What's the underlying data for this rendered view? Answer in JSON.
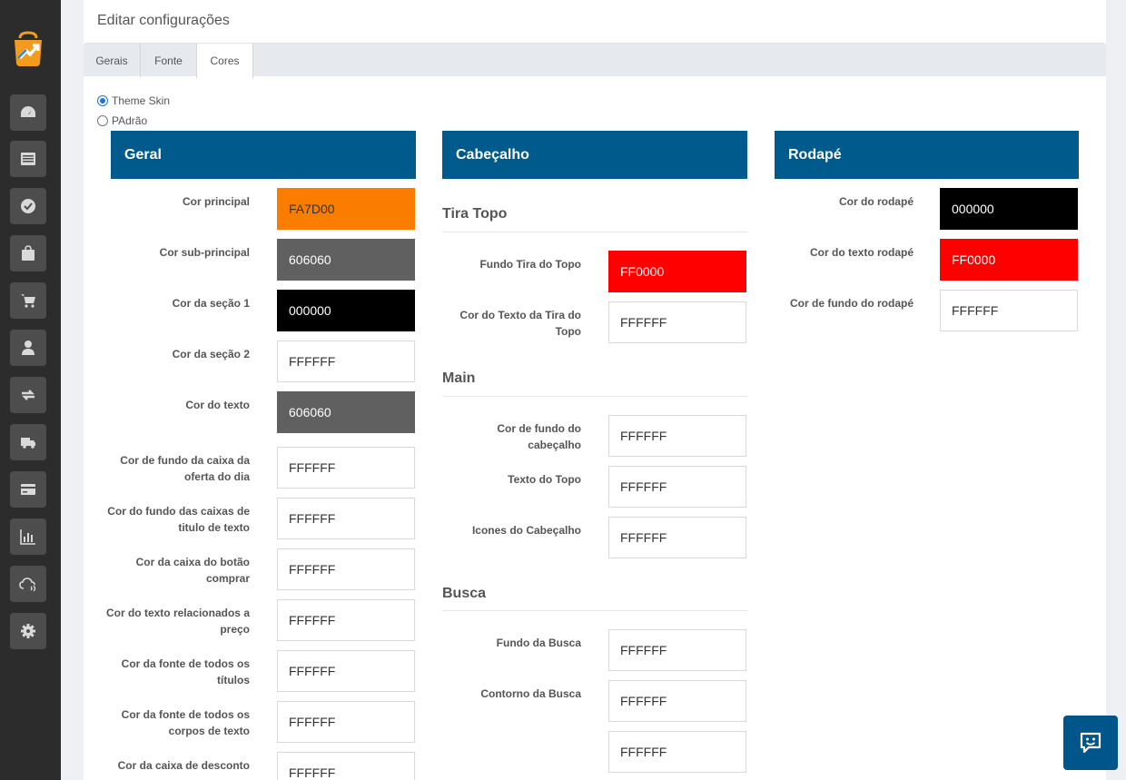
{
  "page_title": "Editar configurações",
  "tabs": [
    {
      "label": "Gerais"
    },
    {
      "label": "Fonte"
    },
    {
      "label": "Cores"
    }
  ],
  "theme_options": [
    {
      "label": "Theme Skin",
      "checked": true
    },
    {
      "label": "PAdrão",
      "checked": false
    }
  ],
  "sidebar_icons": [
    "dashboard-icon",
    "list-icon",
    "check-icon",
    "bag-icon",
    "cart-icon",
    "user-icon",
    "exchange-icon",
    "truck-icon",
    "card-icon",
    "chart-icon",
    "cloud-icon",
    "gear-icon"
  ],
  "geral": {
    "title": "Geral",
    "fields": [
      {
        "label": "Cor principal",
        "value": "FA7D00"
      },
      {
        "label": "Cor sub-principal",
        "value": "606060"
      },
      {
        "label": "Cor da seção 1",
        "value": "000000"
      },
      {
        "label": "Cor da seção 2",
        "value": "FFFFFF"
      },
      {
        "label": "Cor do texto",
        "value": "606060"
      },
      {
        "label": "Cor de fundo da caixa da oferta do dia",
        "value": "FFFFFF"
      },
      {
        "label": "Cor do fundo das caixas de titulo de texto",
        "value": "FFFFFF"
      },
      {
        "label": "Cor da caixa do botão comprar",
        "value": "FFFFFF"
      },
      {
        "label": "Cor do texto relacionados a preço",
        "value": "FFFFFF"
      },
      {
        "label": "Cor da fonte de todos os títulos",
        "value": "FFFFFF"
      },
      {
        "label": "Cor da fonte de todos os corpos de texto",
        "value": "FFFFFF"
      },
      {
        "label": "Cor da caixa de desconto",
        "value": "FFFFFF"
      }
    ]
  },
  "cabecalho": {
    "title": "Cabeçalho",
    "tira_topo": {
      "title": "Tira Topo",
      "fields": [
        {
          "label": "Fundo Tira do Topo",
          "value": "FF0000"
        },
        {
          "label": "Cor do Texto da Tira do Topo",
          "value": "FFFFFF"
        }
      ]
    },
    "main": {
      "title": "Main",
      "fields": [
        {
          "label": "Cor de fundo do cabeçalho",
          "value": "FFFFFF"
        },
        {
          "label": "Texto do Topo",
          "value": "FFFFFF"
        },
        {
          "label": "Icones do Cabeçalho",
          "value": "FFFFFF"
        }
      ]
    },
    "busca": {
      "title": "Busca",
      "fields": [
        {
          "label": "Fundo da Busca",
          "value": "FFFFFF"
        },
        {
          "label": "Contorno da Busca",
          "value": "FFFFFF"
        },
        {
          "label": "",
          "value": "FFFFFF"
        }
      ]
    }
  },
  "rodape": {
    "title": "Rodapé",
    "fields": [
      {
        "label": "Cor do rodapé",
        "value": "000000"
      },
      {
        "label": "Cor do texto rodapé",
        "value": "FF0000"
      },
      {
        "label": "Cor de fundo do rodapé",
        "value": "FFFFFF"
      }
    ]
  },
  "colors": {
    "accent": "#005a8c",
    "sidebar": "#2c2c2c"
  }
}
